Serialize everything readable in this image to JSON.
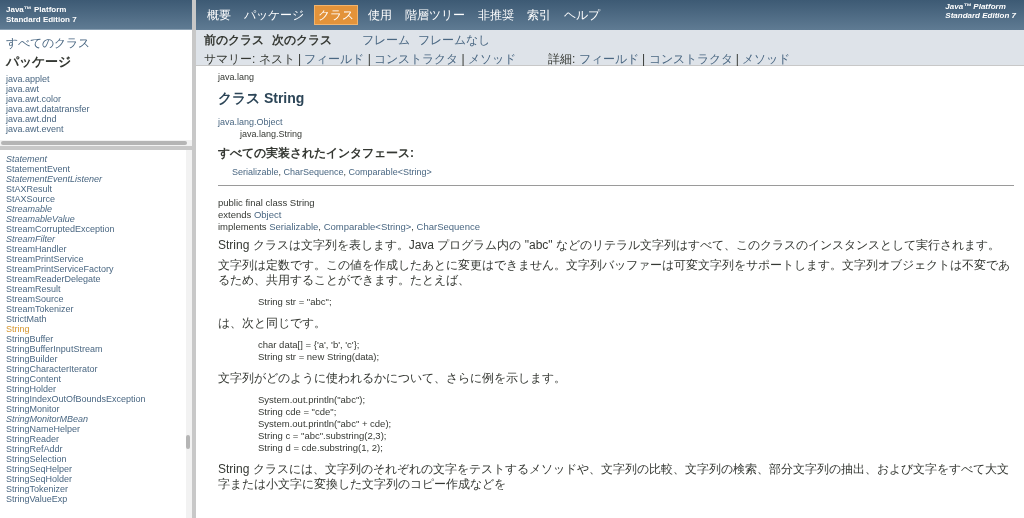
{
  "left_header": {
    "lines": [
      "Java™ Platform",
      "Standard Edition 7"
    ]
  },
  "all_classes": "すべてのクラス",
  "packages_heading": "パッケージ",
  "packages": [
    "java.applet",
    "java.awt",
    "java.awt.color",
    "java.awt.datatransfer",
    "java.awt.dnd",
    "java.awt.event"
  ],
  "classes": [
    {
      "name": "Statement",
      "kind": "interface",
      "selected": false
    },
    {
      "name": "StatementEvent",
      "kind": "class",
      "selected": false
    },
    {
      "name": "StatementEventListener",
      "kind": "interface",
      "selected": false
    },
    {
      "name": "StAXResult",
      "kind": "class",
      "selected": false
    },
    {
      "name": "StAXSource",
      "kind": "class",
      "selected": false
    },
    {
      "name": "Streamable",
      "kind": "interface",
      "selected": false
    },
    {
      "name": "StreamableValue",
      "kind": "interface",
      "selected": false
    },
    {
      "name": "StreamCorruptedException",
      "kind": "class",
      "selected": false
    },
    {
      "name": "StreamFilter",
      "kind": "interface",
      "selected": false
    },
    {
      "name": "StreamHandler",
      "kind": "class",
      "selected": false
    },
    {
      "name": "StreamPrintService",
      "kind": "class",
      "selected": false
    },
    {
      "name": "StreamPrintServiceFactory",
      "kind": "class",
      "selected": false
    },
    {
      "name": "StreamReaderDelegate",
      "kind": "class",
      "selected": false
    },
    {
      "name": "StreamResult",
      "kind": "class",
      "selected": false
    },
    {
      "name": "StreamSource",
      "kind": "class",
      "selected": false
    },
    {
      "name": "StreamTokenizer",
      "kind": "class",
      "selected": false
    },
    {
      "name": "StrictMath",
      "kind": "class",
      "selected": false
    },
    {
      "name": "String",
      "kind": "class",
      "selected": true
    },
    {
      "name": "StringBuffer",
      "kind": "class",
      "selected": false
    },
    {
      "name": "StringBufferInputStream",
      "kind": "class",
      "selected": false
    },
    {
      "name": "StringBuilder",
      "kind": "class",
      "selected": false
    },
    {
      "name": "StringCharacterIterator",
      "kind": "class",
      "selected": false
    },
    {
      "name": "StringContent",
      "kind": "class",
      "selected": false
    },
    {
      "name": "StringHolder",
      "kind": "class",
      "selected": false
    },
    {
      "name": "StringIndexOutOfBoundsException",
      "kind": "class",
      "selected": false
    },
    {
      "name": "StringMonitor",
      "kind": "class",
      "selected": false
    },
    {
      "name": "StringMonitorMBean",
      "kind": "interface",
      "selected": false
    },
    {
      "name": "StringNameHelper",
      "kind": "class",
      "selected": false
    },
    {
      "name": "StringReader",
      "kind": "class",
      "selected": false
    },
    {
      "name": "StringRefAddr",
      "kind": "class",
      "selected": false
    },
    {
      "name": "StringSelection",
      "kind": "class",
      "selected": false
    },
    {
      "name": "StringSeqHelper",
      "kind": "class",
      "selected": false
    },
    {
      "name": "StringSeqHolder",
      "kind": "class",
      "selected": false
    },
    {
      "name": "StringTokenizer",
      "kind": "class",
      "selected": false
    },
    {
      "name": "StringValueExp",
      "kind": "class",
      "selected": false
    }
  ],
  "nav": {
    "items": [
      {
        "label": "概要",
        "selected": false
      },
      {
        "label": "パッケージ",
        "selected": false
      },
      {
        "label": "クラス",
        "selected": true
      },
      {
        "label": "使用",
        "selected": false
      },
      {
        "label": "階層ツリー",
        "selected": false
      },
      {
        "label": "非推奨",
        "selected": false
      },
      {
        "label": "索引",
        "selected": false
      },
      {
        "label": "ヘルプ",
        "selected": false
      }
    ],
    "brand_lines": [
      "Java™ Platform",
      "Standard Edition 7"
    ]
  },
  "subnav": {
    "prev": "前のクラス",
    "next": "次のクラス",
    "frames": "フレーム",
    "no_frames": "フレームなし",
    "summary": {
      "label": "サマリー: ",
      "separator": " | ",
      "items": [
        {
          "text": "ネスト",
          "link": false
        },
        {
          "text": "フィールド",
          "link": true
        },
        {
          "text": "コンストラクタ",
          "link": true
        },
        {
          "text": "メソッド",
          "link": true
        }
      ]
    },
    "detail": {
      "label": "詳細: ",
      "separator": " | ",
      "items": [
        {
          "text": "フィールド",
          "link": true
        },
        {
          "text": "コンストラクタ",
          "link": true
        },
        {
          "text": "メソッド",
          "link": true
        }
      ]
    }
  },
  "content": {
    "package": "java.lang",
    "title": "クラス String",
    "inheritance": [
      {
        "text": "java.lang.Object",
        "link": true
      },
      {
        "text": "java.lang.String",
        "link": false
      }
    ],
    "interfaces_heading": "すべての実装されたインタフェース:",
    "interfaces": {
      "separator": ", ",
      "links": [
        "Serializable",
        "CharSequence",
        "Comparable<String>"
      ]
    },
    "declaration": [
      {
        "keyword": "public final class String"
      },
      {
        "keyword": "extends ",
        "links": [
          "Object"
        ]
      },
      {
        "keyword": "implements ",
        "separator": ", ",
        "links": [
          "Serializable",
          "Comparable<String>",
          "CharSequence"
        ]
      }
    ],
    "body": [
      {
        "kind": "para",
        "text": "String クラスは文字列を表します。Java プログラム内の \"abc\" などのリテラル文字列はすべて、このクラスのインスタンスとして実行されます。"
      },
      {
        "kind": "para",
        "text": "文字列は定数です。この値を作成したあとに変更はできません。文字列バッファーは可変文字列をサポートします。文字列オブジェクトは不変であるため、共用することができます。たとえば、"
      },
      {
        "kind": "code",
        "lines": [
          "String str = \"abc\";"
        ]
      },
      {
        "kind": "para",
        "text": "は、次と同じです。"
      },
      {
        "kind": "code",
        "lines": [
          "char data[] = {'a', 'b', 'c'};",
          "String str = new String(data);"
        ]
      },
      {
        "kind": "para",
        "text": "文字列がどのように使われるかについて、さらに例を示します。"
      },
      {
        "kind": "code",
        "lines": [
          "System.out.println(\"abc\");",
          "String cde = \"cde\";",
          "System.out.println(\"abc\" + cde);",
          "String c = \"abc\".substring(2,3);",
          "String d = cde.substring(1, 2);"
        ]
      },
      {
        "kind": "para",
        "text": "String クラスには、文字列のそれぞれの文字をテストするメソッドや、文字列の比較、文字列の検索、部分文字列の抽出、および文字をすべて大文字または小文字に変換した文字列のコピー作成などを"
      }
    ]
  }
}
